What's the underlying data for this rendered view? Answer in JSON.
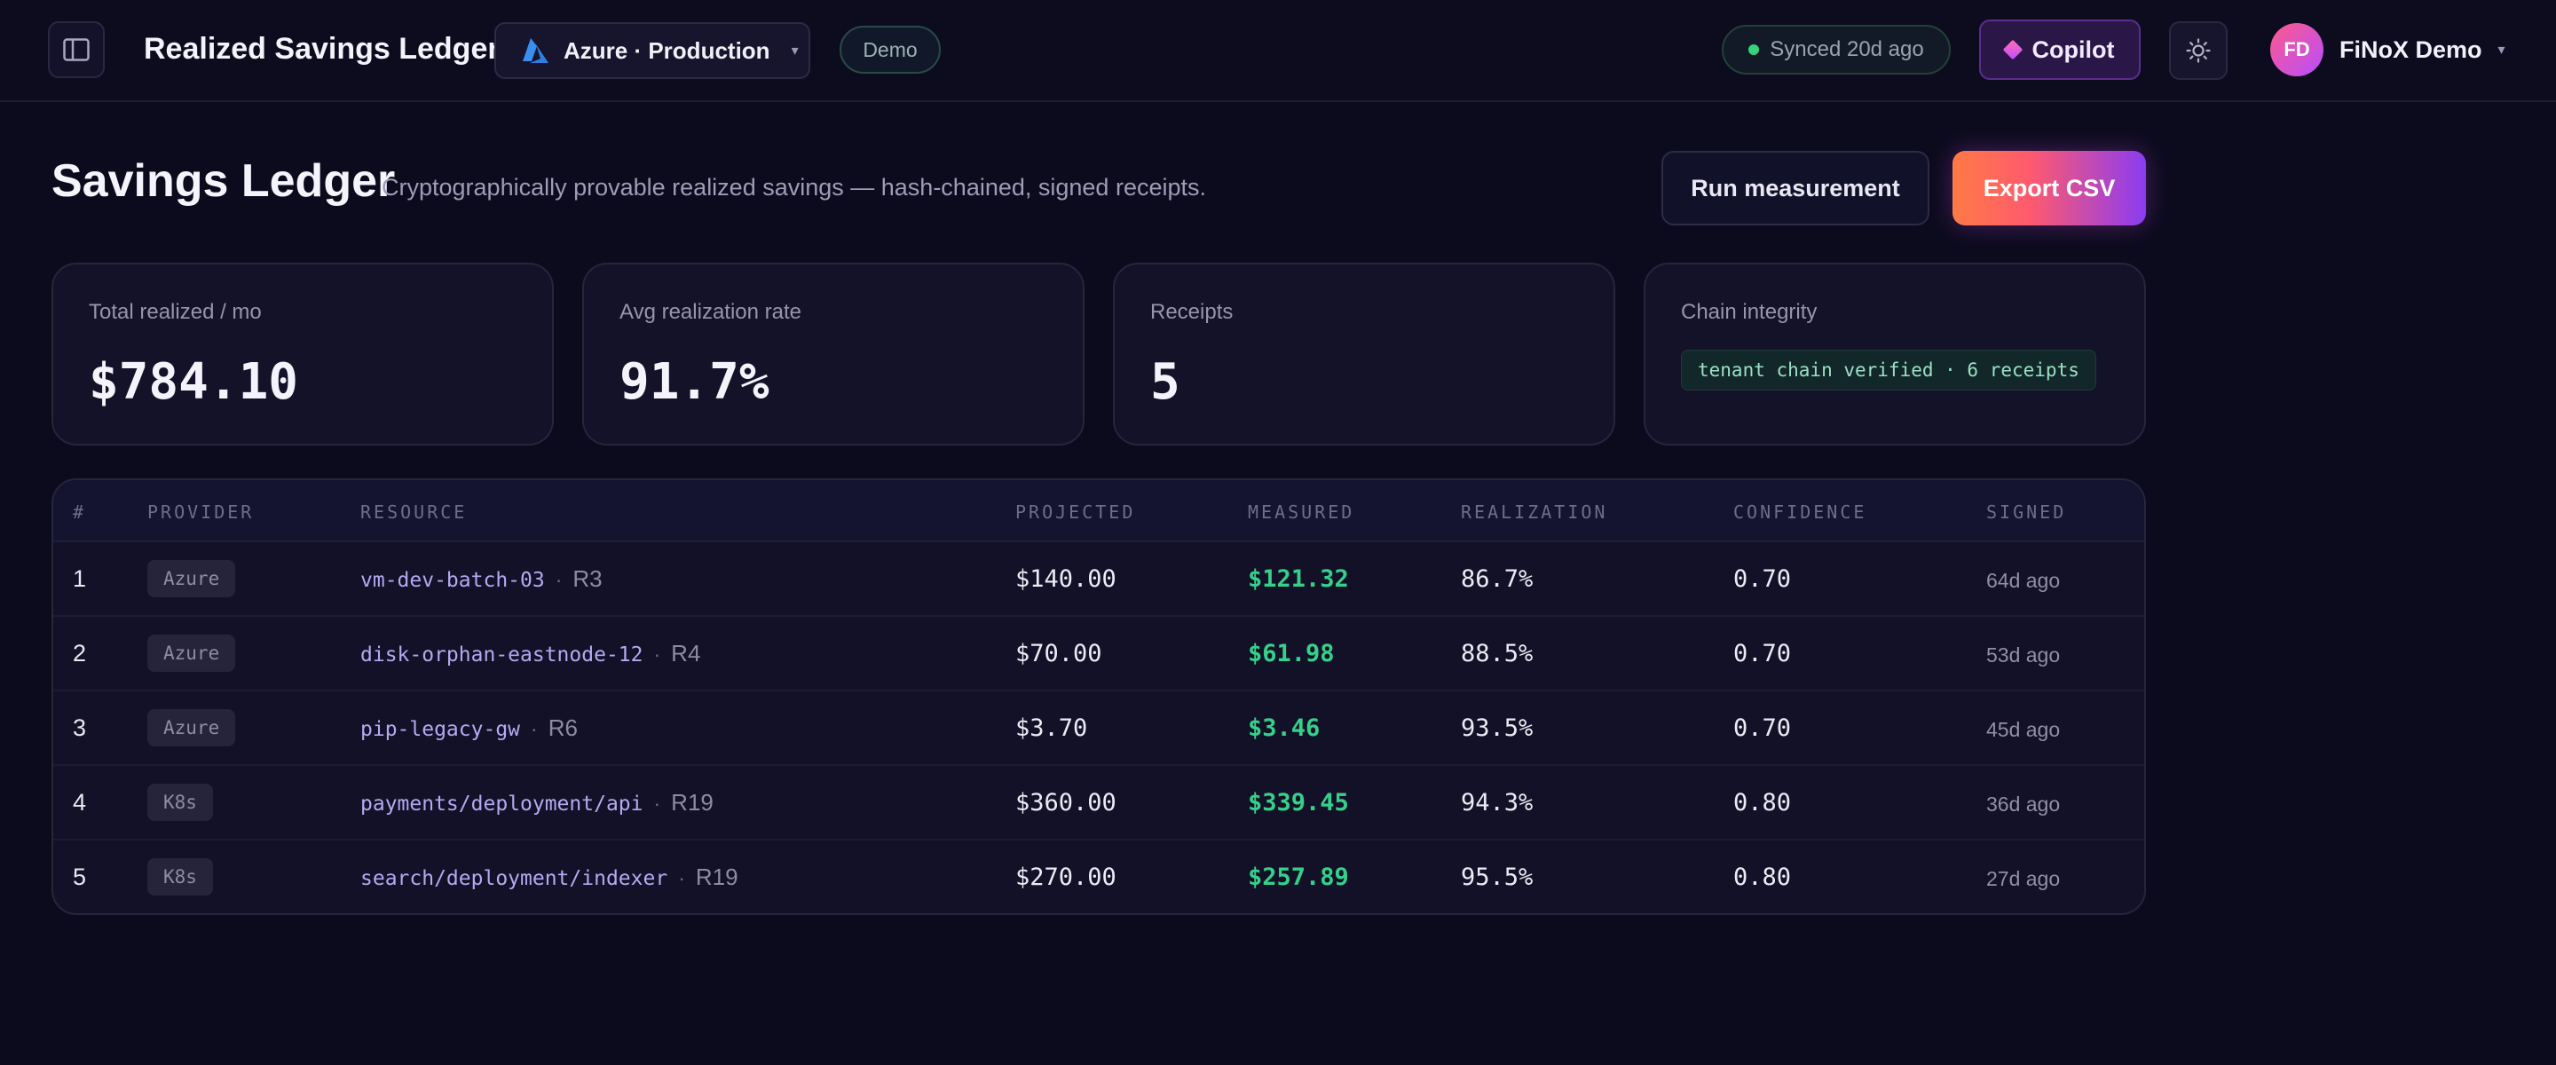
{
  "topbar": {
    "app_title": "Realized Savings Ledger",
    "environment": "Azure · Production",
    "mode_badge": "Demo",
    "sync_status": "Synced 20d ago",
    "copilot_label": "Copilot",
    "user_initials": "FD",
    "user_name": "FiNoX Demo"
  },
  "header": {
    "title": "Savings Ledger",
    "subtitle": "Cryptographically provable realized savings — hash-chained, signed receipts.",
    "run_button": "Run measurement",
    "export_button": "Export CSV"
  },
  "stats": [
    {
      "label": "Total realized / mo",
      "value": "$784.10"
    },
    {
      "label": "Avg realization rate",
      "value": "91.7%"
    },
    {
      "label": "Receipts",
      "value": "5"
    },
    {
      "label": "Chain integrity",
      "value": "tenant chain verified · 6 receipts"
    }
  ],
  "table": {
    "columns": [
      "#",
      "PROVIDER",
      "RESOURCE",
      "PROJECTED",
      "MEASURED",
      "REALIZATION",
      "CONFIDENCE",
      "SIGNED"
    ],
    "rows": [
      {
        "idx": "1",
        "provider": "Azure",
        "resource": "vm-dev-batch-03",
        "ref": "R3",
        "projected": "$140.00",
        "measured": "$121.32",
        "realization": "86.7%",
        "confidence": "0.70",
        "signed": "64d ago"
      },
      {
        "idx": "2",
        "provider": "Azure",
        "resource": "disk-orphan-eastnode-12",
        "ref": "R4",
        "projected": "$70.00",
        "measured": "$61.98",
        "realization": "88.5%",
        "confidence": "0.70",
        "signed": "53d ago"
      },
      {
        "idx": "3",
        "provider": "Azure",
        "resource": "pip-legacy-gw",
        "ref": "R6",
        "projected": "$3.70",
        "measured": "$3.46",
        "realization": "93.5%",
        "confidence": "0.70",
        "signed": "45d ago"
      },
      {
        "idx": "4",
        "provider": "K8s",
        "resource": "payments/deployment/api",
        "ref": "R19",
        "projected": "$360.00",
        "measured": "$339.45",
        "realization": "94.3%",
        "confidence": "0.80",
        "signed": "36d ago"
      },
      {
        "idx": "5",
        "provider": "K8s",
        "resource": "search/deployment/indexer",
        "ref": "R19",
        "projected": "$270.00",
        "measured": "$257.89",
        "realization": "95.5%",
        "confidence": "0.80",
        "signed": "27d ago"
      }
    ]
  },
  "icons": {
    "sidebar_toggle": "sidebar-toggle-icon",
    "environment": "azure-logo-icon",
    "copilot": "diamond-icon",
    "theme": "sun-icon",
    "caret": "chevron-down-icon"
  },
  "colors": {
    "accent_green": "#35d08a",
    "resource_purple": "#b5a9f0",
    "export_gradient_start": "#ff7a45",
    "export_gradient_end": "#8a3cf2"
  }
}
